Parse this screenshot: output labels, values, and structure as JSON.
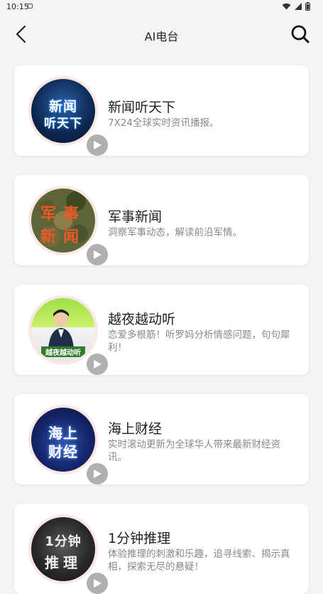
{
  "status_bar": {
    "time": "10:15"
  },
  "header": {
    "title": "AI电台"
  },
  "stations": [
    {
      "title": "新闻听天下",
      "description": "7X24全球实时资讯播报。",
      "cover_text": [
        "新闻",
        "听天下"
      ]
    },
    {
      "title": "军事新闻",
      "description": "洞察军事动态，解读前沿军情。",
      "cover_text": [
        "军事",
        "新闻"
      ]
    },
    {
      "title": "越夜越动听",
      "description": "恋爱多根筋！听罗妈分析情感问题，句句犀利！",
      "cover_text": [
        "越夜越动听"
      ]
    },
    {
      "title": "海上财经",
      "description": "实时滚动更新为全球华人带来最新财经资讯。",
      "cover_text": [
        "海上",
        "财经"
      ]
    },
    {
      "title": "1分钟推理",
      "description": "体验推理的刺激和乐趣，追寻线索、揭示真相，探索无尽的悬疑！",
      "cover_text": [
        "1分钟",
        "推理"
      ]
    }
  ],
  "colors": {
    "background": "#f4f4f4",
    "card": "#ffffff",
    "title": "#222222",
    "description": "#888888",
    "cover_ring": "#fbe7e4"
  },
  "icons": {
    "back": "chevron-left-icon",
    "search": "search-icon",
    "play": "play-icon"
  }
}
